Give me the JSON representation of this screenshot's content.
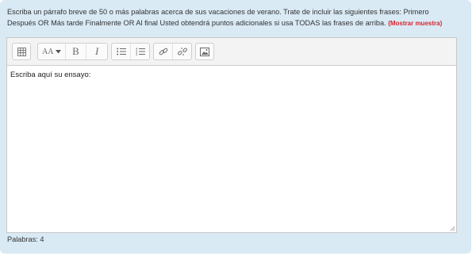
{
  "question": {
    "text": "Escriba un párrafo breve de 50 o más palabras acerca de sus vacaciones de verano. Trate de incluir las siguientes frases: Primero Después OR Más tarde Finalmente OR Al final Usted obtendrá puntos adicionales si usa TODAS las frases de arriba.",
    "show_sample_link": "(Mostrar muestra)"
  },
  "toolbar": {
    "icons": [
      "toolbar-toggle-icon",
      "font-size-icon",
      "bold-icon",
      "italic-icon",
      "unordered-list-icon",
      "ordered-list-icon",
      "link-icon",
      "unlink-icon",
      "image-icon"
    ],
    "font_size_label": "AA",
    "bold_label": "B",
    "italic_label": "I"
  },
  "editor": {
    "content": "Escriba aquí su ensayo:"
  },
  "footer": {
    "word_count_label": "Palabras: 4"
  }
}
